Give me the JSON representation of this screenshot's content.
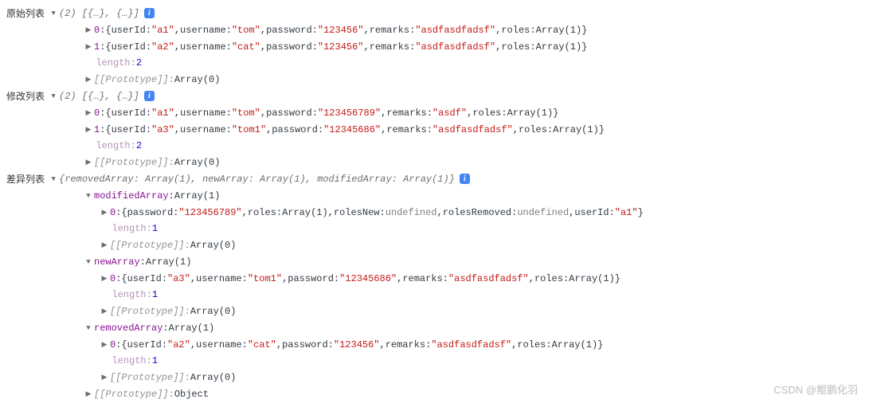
{
  "watermark": "CSDN @鲲鹏化羽",
  "sections": [
    {
      "id": "original",
      "label": "原始列表",
      "summary": "(2) [{…}, {…}]",
      "hasInfo": true,
      "children": [
        {
          "type": "obj",
          "idx": "0",
          "props": [
            {
              "k": "userId",
              "t": "str",
              "v": "\"a1\""
            },
            {
              "k": "username",
              "t": "str",
              "v": "\"tom\""
            },
            {
              "k": "password",
              "t": "str",
              "v": "\"123456\""
            },
            {
              "k": "remarks",
              "t": "str",
              "v": "\"asdfasdfadsf\""
            },
            {
              "k": "roles",
              "t": "plain",
              "v": "Array(1)"
            }
          ]
        },
        {
          "type": "obj",
          "idx": "1",
          "props": [
            {
              "k": "userId",
              "t": "str",
              "v": "\"a2\""
            },
            {
              "k": "username",
              "t": "str",
              "v": "\"cat\""
            },
            {
              "k": "password",
              "t": "str",
              "v": "\"123456\""
            },
            {
              "k": "remarks",
              "t": "str",
              "v": "\"asdfasdfadsf\""
            },
            {
              "k": "roles",
              "t": "plain",
              "v": "Array(1)"
            }
          ]
        },
        {
          "type": "length",
          "v": "2"
        },
        {
          "type": "proto",
          "v": "Array(0)"
        }
      ]
    },
    {
      "id": "modified",
      "label": "修改列表",
      "summary": "(2) [{…}, {…}]",
      "hasInfo": true,
      "children": [
        {
          "type": "obj",
          "idx": "0",
          "props": [
            {
              "k": "userId",
              "t": "str",
              "v": "\"a1\""
            },
            {
              "k": "username",
              "t": "str",
              "v": "\"tom\""
            },
            {
              "k": "password",
              "t": "str",
              "v": "\"123456789\""
            },
            {
              "k": "remarks",
              "t": "str",
              "v": "\"asdf\""
            },
            {
              "k": "roles",
              "t": "plain",
              "v": "Array(1)"
            }
          ]
        },
        {
          "type": "obj",
          "idx": "1",
          "props": [
            {
              "k": "userId",
              "t": "str",
              "v": "\"a3\""
            },
            {
              "k": "username",
              "t": "str",
              "v": "\"tom1\""
            },
            {
              "k": "password",
              "t": "str",
              "v": "\"12345686\""
            },
            {
              "k": "remarks",
              "t": "str",
              "v": "\"asdfasdfadsf\""
            },
            {
              "k": "roles",
              "t": "plain",
              "v": "Array(1)"
            }
          ]
        },
        {
          "type": "length",
          "v": "2"
        },
        {
          "type": "proto",
          "v": "Array(0)"
        }
      ]
    }
  ],
  "diff": {
    "label": "差异列表",
    "summary": "{removedArray: Array(1), newArray: Array(1), modifiedArray: Array(1)}",
    "hasInfo": true,
    "arrays": [
      {
        "name": "modifiedArray",
        "typeText": "Array(1)",
        "item": {
          "idx": "0",
          "props": [
            {
              "k": "password",
              "t": "str",
              "v": "\"123456789\""
            },
            {
              "k": "roles",
              "t": "plain",
              "v": "Array(1)"
            },
            {
              "k": "rolesNew",
              "t": "undef",
              "v": "undefined"
            },
            {
              "k": "rolesRemoved",
              "t": "undef",
              "v": "undefined"
            },
            {
              "k": "userId",
              "t": "str",
              "v": "\"a1\""
            }
          ]
        },
        "length": "1",
        "proto": "Array(0)"
      },
      {
        "name": "newArray",
        "typeText": "Array(1)",
        "item": {
          "idx": "0",
          "props": [
            {
              "k": "userId",
              "t": "str",
              "v": "\"a3\""
            },
            {
              "k": "username",
              "t": "str",
              "v": "\"tom1\""
            },
            {
              "k": "password",
              "t": "str",
              "v": "\"12345686\""
            },
            {
              "k": "remarks",
              "t": "str",
              "v": "\"asdfasdfadsf\""
            },
            {
              "k": "roles",
              "t": "plain",
              "v": "Array(1)"
            }
          ]
        },
        "length": "1",
        "proto": "Array(0)"
      },
      {
        "name": "removedArray",
        "typeText": "Array(1)",
        "item": {
          "idx": "0",
          "props": [
            {
              "k": "userId",
              "t": "str",
              "v": "\"a2\""
            },
            {
              "k": "username",
              "t": "str",
              "v": "\"cat\""
            },
            {
              "k": "password",
              "t": "str",
              "v": "\"123456\""
            },
            {
              "k": "remarks",
              "t": "str",
              "v": "\"asdfasdfadsf\""
            },
            {
              "k": "roles",
              "t": "plain",
              "v": "Array(1)"
            }
          ]
        },
        "length": "1",
        "proto": "Array(0)"
      }
    ],
    "proto": "Object"
  }
}
